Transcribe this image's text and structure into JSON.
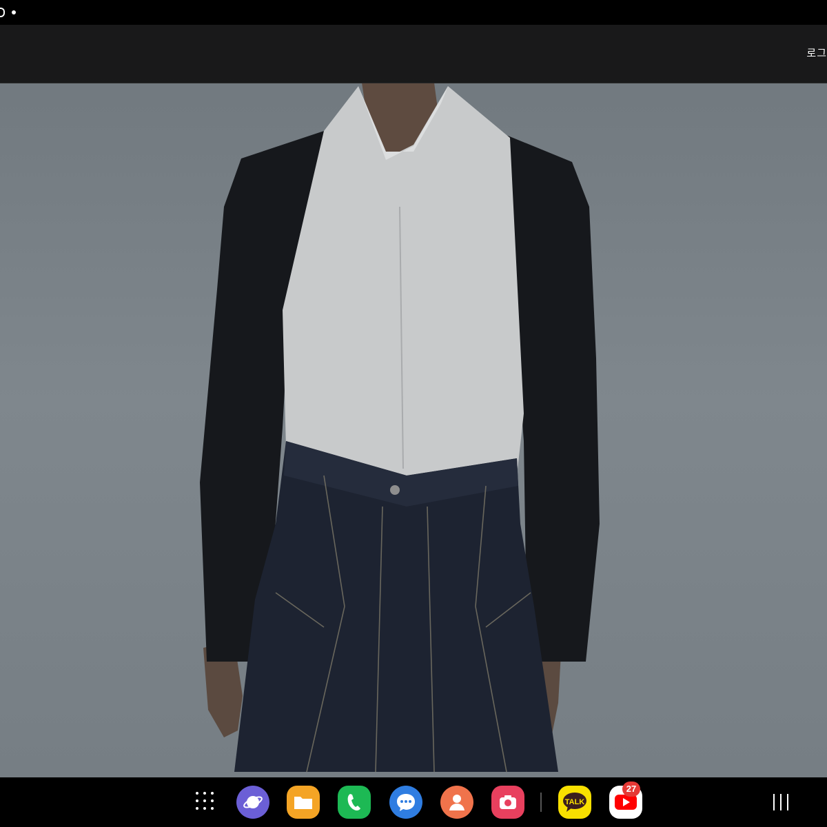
{
  "header": {
    "login_label": "로그"
  },
  "photo": {
    "description_icon": "fashion-photo"
  },
  "taskbar": {
    "apps": [
      {
        "name": "internet",
        "color": "#6b5fd6"
      },
      {
        "name": "files",
        "color": "#f4a425"
      },
      {
        "name": "phone",
        "color": "#1db954"
      },
      {
        "name": "messages",
        "color": "#2f7de1"
      },
      {
        "name": "contacts",
        "color": "#f0734b"
      },
      {
        "name": "camera",
        "color": "#e8405e"
      },
      {
        "name": "kakaotalk",
        "color": "#f9e000",
        "label": "TALK"
      },
      {
        "name": "youtube",
        "color": "#ffffff"
      }
    ],
    "youtube_badge": "27"
  },
  "colors": {
    "background": "#000000",
    "header": "#121212",
    "photo_wall": "#7d858b"
  }
}
